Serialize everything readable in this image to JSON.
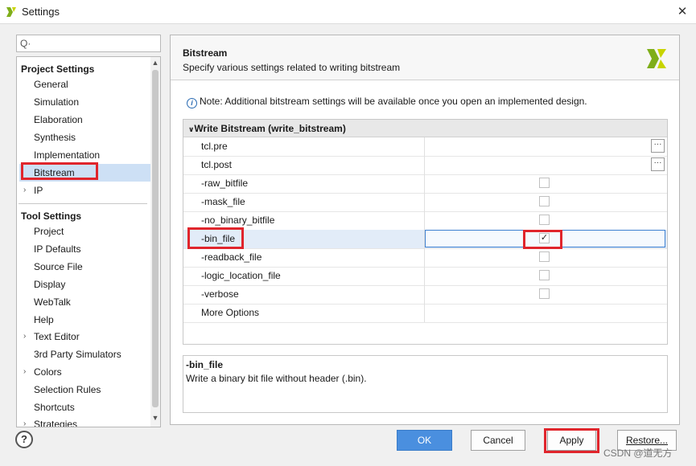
{
  "window": {
    "title": "Settings",
    "close_symbol": "✕"
  },
  "search": {
    "icon_glyph": "Q·"
  },
  "nav": {
    "project_settings_header": "Project Settings",
    "project_items": [
      "General",
      "Simulation",
      "Elaboration",
      "Synthesis",
      "Implementation",
      "Bitstream",
      "IP"
    ],
    "tool_settings_header": "Tool Settings",
    "tool_items": [
      "Project",
      "IP Defaults",
      "Source File",
      "Display",
      "WebTalk",
      "Help",
      "Text Editor",
      "3rd Party Simulators",
      "Colors",
      "Selection Rules",
      "Shortcuts",
      "Strategies"
    ],
    "selected": "Bitstream"
  },
  "panel": {
    "title": "Bitstream",
    "subtitle": "Specify various settings related to writing bitstream",
    "note": "Note: Additional bitstream settings will be available once you open an implemented design.",
    "group_label": "Write Bitstream (write_bitstream)",
    "rows": [
      {
        "label": "tcl.pre",
        "type": "browse",
        "checked": false
      },
      {
        "label": "tcl.post",
        "type": "browse",
        "checked": false
      },
      {
        "label": "-raw_bitfile",
        "type": "checkbox",
        "checked": false
      },
      {
        "label": "-mask_file",
        "type": "checkbox",
        "checked": false
      },
      {
        "label": "-no_binary_bitfile",
        "type": "checkbox",
        "checked": false
      },
      {
        "label": "-bin_file",
        "type": "checkbox",
        "checked": true
      },
      {
        "label": "-readback_file",
        "type": "checkbox",
        "checked": false
      },
      {
        "label": "-logic_location_file",
        "type": "checkbox",
        "checked": false
      },
      {
        "label": "-verbose",
        "type": "checkbox",
        "checked": false
      },
      {
        "label": "More Options",
        "type": "text",
        "checked": false
      }
    ],
    "description_title": "-bin_file",
    "description_text": "Write a binary bit file without header (.bin)."
  },
  "footer": {
    "help_label": "?",
    "ok_label": "OK",
    "cancel_label": "Cancel",
    "apply_label": "Apply",
    "restore_label": "Restore..."
  },
  "watermark": "CSDN @道无方",
  "colors": {
    "accent": "#4a8fdf",
    "selection": "#cde0f5",
    "highlight_box": "#e0252c"
  }
}
